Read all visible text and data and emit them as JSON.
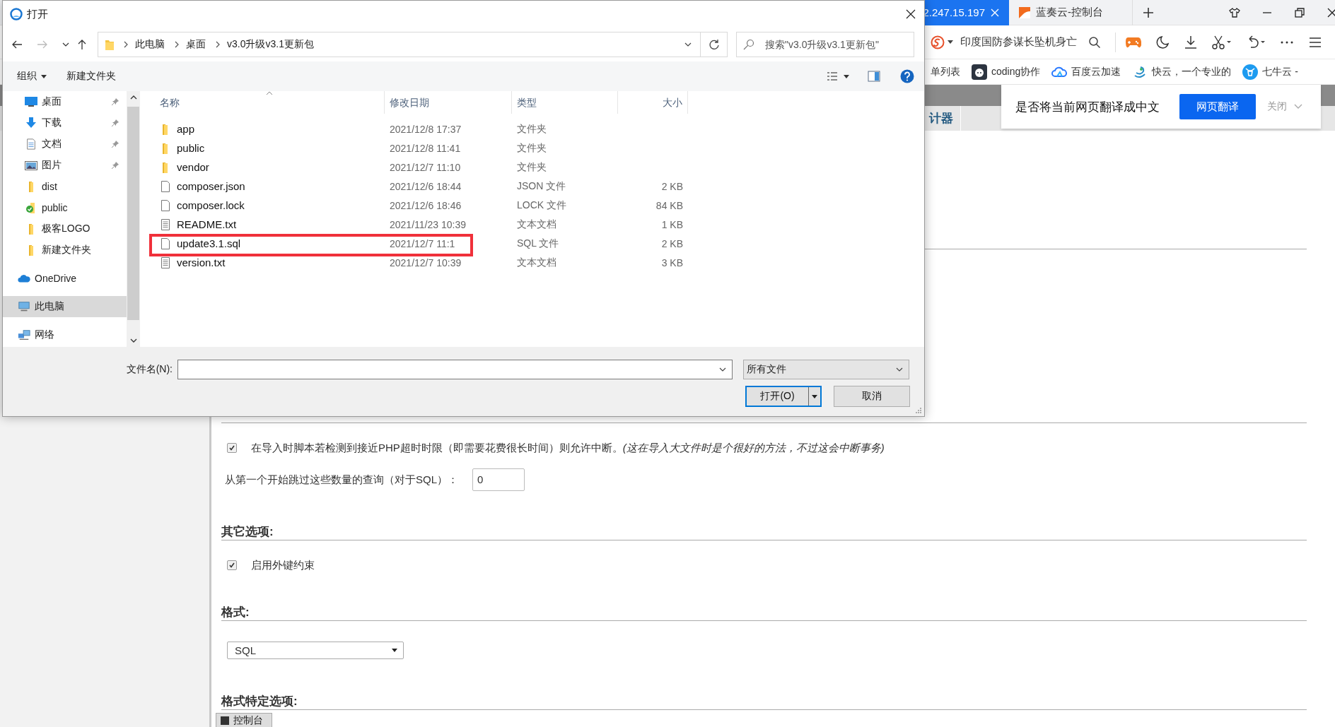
{
  "browser": {
    "tabs": [
      {
        "label": "2.247.15.197",
        "selected": true
      },
      {
        "label": "蓝奏云-控制台",
        "selected": false
      }
    ],
    "search": {
      "value": "印度国防参谋长坠机身亡"
    },
    "bookmarks": [
      {
        "label": "单列表",
        "kind": "none"
      },
      {
        "label": "coding协作",
        "kind": "coding"
      },
      {
        "label": "百度云加速",
        "kind": "cloud"
      },
      {
        "label": "快云，一个专业的",
        "kind": "swirl"
      },
      {
        "label": "七牛云 -",
        "kind": "bull"
      }
    ],
    "menu_tab": "计器",
    "translate_bar": {
      "prompt": "是否将当前网页翻译成中文",
      "button": "网页翻译",
      "close": "关闭"
    }
  },
  "page": {
    "sections": [
      {
        "items": [
          {
            "kind": "checkbox",
            "label": "在导入时脚本若检测到接近PHP超时时限（即需要花费很长时间）则允许中断。*(这在导入大文件时是个很好的方法，不过这会中断事务)*",
            "checked": true
          },
          {
            "kind": "number",
            "label": "从第一个开始跳过这些数量的查询（对于SQL）：",
            "value": "0"
          }
        ]
      },
      {
        "heading": "其它选项:",
        "items": [
          {
            "kind": "checkbox",
            "label": "启用外键约束",
            "checked": true
          }
        ]
      },
      {
        "heading": "格式:",
        "items": [
          {
            "kind": "select",
            "value": "SQL"
          }
        ]
      },
      {
        "heading": "格式特定选项:"
      }
    ],
    "console_tab": "控制台"
  },
  "dialog": {
    "title": "打开",
    "breadcrumb": [
      "此电脑",
      "桌面",
      "v3.0升级v3.1更新包"
    ],
    "search": {
      "placeholder": "搜索\"v3.0升级v3.1更新包\""
    },
    "toolbar": {
      "organize": "组织",
      "new_folder": "新建文件夹"
    },
    "sidebar": {
      "quick_access": [
        {
          "label": "桌面",
          "kind": "desktop",
          "pinned": true,
          "selected": false
        },
        {
          "label": "下载",
          "kind": "download",
          "pinned": true,
          "selected": false
        },
        {
          "label": "文档",
          "kind": "document",
          "pinned": true,
          "selected": false
        },
        {
          "label": "图片",
          "kind": "picture",
          "pinned": true,
          "selected": false
        },
        {
          "label": "dist",
          "kind": "folder",
          "pinned": false,
          "selected": false
        },
        {
          "label": "public",
          "kind": "synced",
          "pinned": false,
          "selected": false
        },
        {
          "label": "极客LOGO",
          "kind": "folder",
          "pinned": false,
          "selected": false
        },
        {
          "label": "新建文件夹",
          "kind": "folder",
          "pinned": false,
          "selected": false
        }
      ],
      "locations": [
        {
          "label": "OneDrive",
          "kind": "cloud",
          "selected": false
        },
        {
          "label": "此电脑",
          "kind": "computer",
          "selected": true
        },
        {
          "label": "网络",
          "kind": "network",
          "selected": false
        }
      ]
    },
    "columns": [
      "名称",
      "修改日期",
      "类型",
      "大小"
    ],
    "files": [
      {
        "name": "app",
        "date": "2021/12/8 17:37",
        "type": "文件夹",
        "kind": "folder",
        "highlighted": false
      },
      {
        "name": "public",
        "date": "2021/12/8 11:41",
        "type": "文件夹",
        "kind": "folder",
        "highlighted": false
      },
      {
        "name": "vendor",
        "date": "2021/12/7 11:10",
        "type": "文件夹",
        "kind": "folder",
        "highlighted": false
      },
      {
        "name": "composer.json",
        "date": "2021/12/6 18:44",
        "type": "JSON 文件",
        "size": "2 KB",
        "kind": "file",
        "highlighted": false
      },
      {
        "name": "composer.lock",
        "date": "2021/12/6 18:46",
        "type": "LOCK 文件",
        "size": "84 KB",
        "kind": "file",
        "highlighted": false
      },
      {
        "name": "README.txt",
        "date": "2021/11/23 10:39",
        "type": "文本文档",
        "size": "1 KB",
        "kind": "text",
        "highlighted": false
      },
      {
        "name": "update3.1.sql",
        "date": "2021/12/7 11:1",
        "type": "SQL 文件",
        "size": "2 KB",
        "kind": "file",
        "highlighted": true
      },
      {
        "name": "version.txt",
        "date": "2021/12/7 10:39",
        "type": "文本文档",
        "size": "3 KB",
        "kind": "text",
        "highlighted": false
      }
    ],
    "filename_label": "文件名(N):",
    "filter": "所有文件",
    "buttons": {
      "open": "打开(O)",
      "cancel": "取消"
    }
  }
}
